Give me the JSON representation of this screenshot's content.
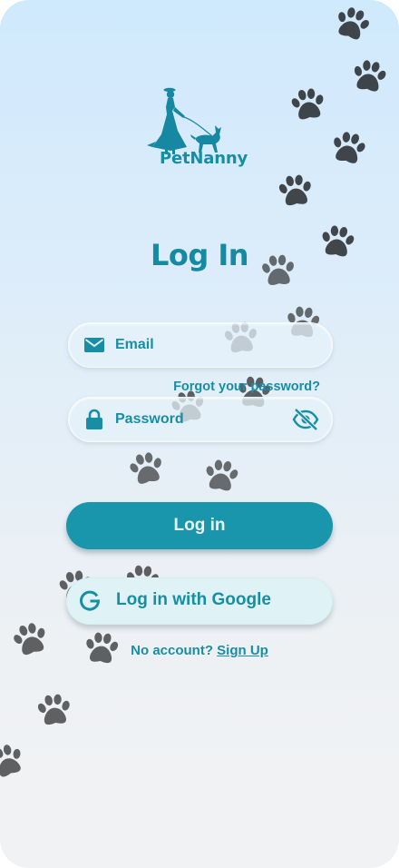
{
  "brand": {
    "name": "PetNanny",
    "logo_icon": "dog-walker-logo-icon"
  },
  "page": {
    "title": "Log In"
  },
  "form": {
    "email": {
      "placeholder": "Email",
      "value": "",
      "icon": "envelope-icon"
    },
    "forgot_password_label": "Forgot your password?",
    "password": {
      "placeholder": "Password",
      "value": "",
      "icon": "lock-icon",
      "toggle_icon": "eye-slash-icon"
    }
  },
  "actions": {
    "login_label": "Log in",
    "google_label": "Log in with Google",
    "google_icon": "google-g-icon"
  },
  "signup": {
    "prompt": "No account?",
    "link_label": "Sign Up"
  },
  "colors": {
    "accent": "#1995ac",
    "text": "#178ea6",
    "paw": "#b9d6ea"
  },
  "background_icon": "paw-print-icon"
}
